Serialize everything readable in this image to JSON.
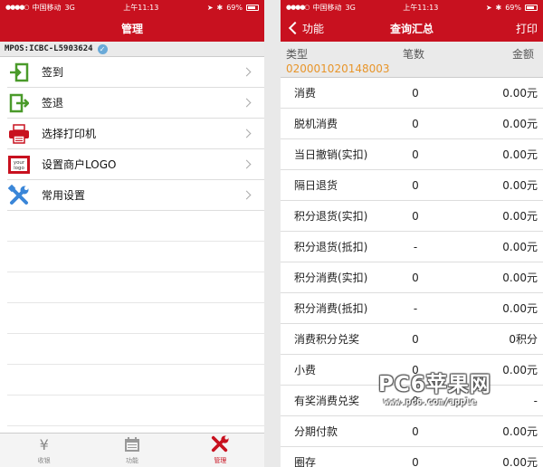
{
  "status_bar": {
    "carrier": "中国移动",
    "network": "3G",
    "time": "上午11:13",
    "battery": "69%"
  },
  "left": {
    "nav_title": "管理",
    "device_id": "MPOS:ICBC-L5903624",
    "menu": [
      {
        "label": "签到",
        "icon": "sign-in-icon"
      },
      {
        "label": "签退",
        "icon": "sign-out-icon"
      },
      {
        "label": "选择打印机",
        "icon": "printer-icon"
      },
      {
        "label": "设置商户LOGO",
        "icon": "logo-icon"
      },
      {
        "label": "常用设置",
        "icon": "tools-icon"
      }
    ],
    "logo_icon_text": [
      "your",
      "logo"
    ],
    "tabs": [
      {
        "label": "收银",
        "icon": "yen-icon",
        "glyph": "¥"
      },
      {
        "label": "功能",
        "icon": "calendar-icon"
      },
      {
        "label": "管理",
        "icon": "tools-icon"
      }
    ]
  },
  "right": {
    "back_label": "功能",
    "nav_title": "查询汇总",
    "print_label": "打印",
    "header": {
      "type": "类型",
      "count": "笔数",
      "amount": "金额",
      "code": "020001020148003"
    },
    "rows": [
      {
        "type": "消费",
        "count": "0",
        "amount": "0.00元"
      },
      {
        "type": "脱机消费",
        "count": "0",
        "amount": "0.00元"
      },
      {
        "type": "当日撤销(实扣)",
        "count": "0",
        "amount": "0.00元"
      },
      {
        "type": "隔日退货",
        "count": "0",
        "amount": "0.00元"
      },
      {
        "type": "积分退货(实扣)",
        "count": "0",
        "amount": "0.00元"
      },
      {
        "type": "积分退货(抵扣)",
        "count": "-",
        "amount": "0.00元"
      },
      {
        "type": "积分消费(实扣)",
        "count": "0",
        "amount": "0.00元"
      },
      {
        "type": "积分消费(抵扣)",
        "count": "-",
        "amount": "0.00元"
      },
      {
        "type": "消费积分兑奖",
        "count": "0",
        "amount": "0积分"
      },
      {
        "type": "小费",
        "count": "0",
        "amount": "0.00元"
      },
      {
        "type": "有奖消费兑奖",
        "count": "0",
        "amount": "-"
      },
      {
        "type": "分期付款",
        "count": "0",
        "amount": "0.00元"
      },
      {
        "type": "圈存",
        "count": "0",
        "amount": "0.00元"
      }
    ]
  },
  "watermark": {
    "main": "PC6苹果网",
    "sub": "www.pc6.com/apple"
  },
  "colors": {
    "brand_red": "#c8111f",
    "code_orange": "#e8952a",
    "icon_green": "#4a9a2a",
    "icon_blue": "#3a86d8"
  }
}
